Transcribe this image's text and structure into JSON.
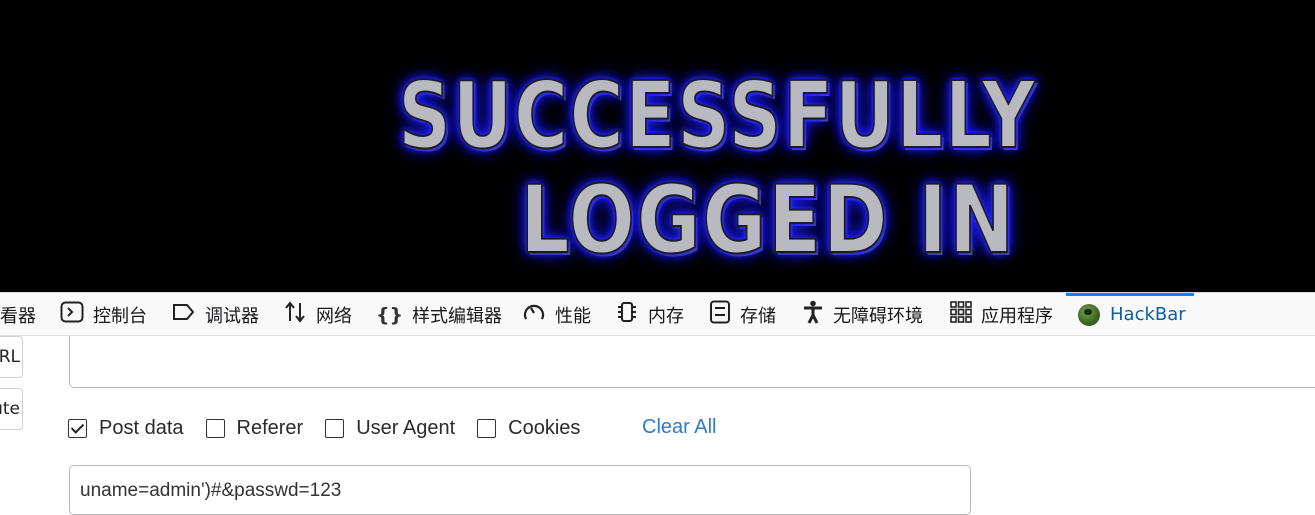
{
  "banner": {
    "line1": "SUCCESSFULLY",
    "line2": "LOGGED IN",
    "glow_color": "#2323ff",
    "text_color": "#b9b9c0"
  },
  "devtools": {
    "tabs": [
      {
        "label": "看器",
        "icon": "inspector-icon"
      },
      {
        "label": "控制台",
        "icon": "console-icon"
      },
      {
        "label": "调试器",
        "icon": "debugger-icon"
      },
      {
        "label": "网络",
        "icon": "network-icon"
      },
      {
        "label": "样式编辑器",
        "icon": "style-editor-icon"
      },
      {
        "label": "性能",
        "icon": "performance-icon"
      },
      {
        "label": "内存",
        "icon": "memory-icon"
      },
      {
        "label": "存储",
        "icon": "storage-icon"
      },
      {
        "label": "无障碍环境",
        "icon": "accessibility-icon"
      },
      {
        "label": "应用程序",
        "icon": "application-icon"
      },
      {
        "label": "HackBar",
        "icon": "hackbar-logo-icon",
        "active": true
      }
    ],
    "active_color": "#0a84ff"
  },
  "hackbar": {
    "side_buttons": [
      "URL",
      "ute"
    ],
    "url_value": "",
    "options": [
      {
        "label": "Post data",
        "checked": true
      },
      {
        "label": "Referer",
        "checked": false
      },
      {
        "label": "User Agent",
        "checked": false
      },
      {
        "label": "Cookies",
        "checked": false
      }
    ],
    "clear_all_label": "Clear All",
    "post_data_value": "uname=admin')#&passwd=123"
  }
}
